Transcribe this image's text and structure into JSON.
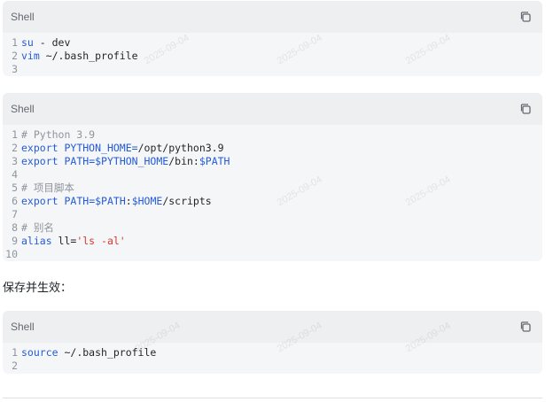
{
  "blocks": [
    {
      "language": "Shell",
      "lines": [
        {
          "n": "1",
          "tokens": [
            [
              "kw",
              "su"
            ],
            [
              "txt",
              " - dev"
            ]
          ]
        },
        {
          "n": "2",
          "tokens": [
            [
              "kw",
              "vim"
            ],
            [
              "txt",
              " ~/.bash_profile"
            ]
          ]
        },
        {
          "n": "3",
          "tokens": []
        }
      ]
    },
    {
      "language": "Shell",
      "lines": [
        {
          "n": "1",
          "tokens": [
            [
              "cm",
              "# Python 3.9"
            ]
          ]
        },
        {
          "n": "2",
          "tokens": [
            [
              "kw",
              "export"
            ],
            [
              "txt",
              " "
            ],
            [
              "var",
              "PYTHON_HOME"
            ],
            [
              "kw",
              "="
            ],
            [
              "txt",
              "/opt/python3.9"
            ]
          ]
        },
        {
          "n": "3",
          "tokens": [
            [
              "kw",
              "export"
            ],
            [
              "txt",
              " "
            ],
            [
              "var",
              "PATH"
            ],
            [
              "kw",
              "="
            ],
            [
              "var",
              "$PYTHON_HOME"
            ],
            [
              "txt",
              "/bin:"
            ],
            [
              "var",
              "$PATH"
            ]
          ]
        },
        {
          "n": "4",
          "tokens": []
        },
        {
          "n": "5",
          "tokens": [
            [
              "cm",
              "# 项目脚本"
            ]
          ]
        },
        {
          "n": "6",
          "tokens": [
            [
              "kw",
              "export"
            ],
            [
              "txt",
              " "
            ],
            [
              "var",
              "PATH"
            ],
            [
              "kw",
              "="
            ],
            [
              "var",
              "$PATH"
            ],
            [
              "txt",
              ":"
            ],
            [
              "var",
              "$HOME"
            ],
            [
              "txt",
              "/scripts"
            ]
          ]
        },
        {
          "n": "7",
          "tokens": []
        },
        {
          "n": "8",
          "tokens": [
            [
              "cm",
              "# 别名"
            ]
          ]
        },
        {
          "n": "9",
          "tokens": [
            [
              "kw",
              "alias"
            ],
            [
              "txt",
              " ll="
            ],
            [
              "str",
              "'ls -al'"
            ]
          ]
        },
        {
          "n": "10",
          "tokens": []
        }
      ]
    },
    {
      "language": "Shell",
      "lines": [
        {
          "n": "1",
          "tokens": [
            [
              "kw",
              "source"
            ],
            [
              "txt",
              " ~/.bash_profile"
            ]
          ]
        },
        {
          "n": "2",
          "tokens": []
        }
      ]
    }
  ],
  "paragraph": "保存并生效：",
  "watermark": "2025-09-04",
  "icons": {
    "copy": "copy-icon"
  }
}
